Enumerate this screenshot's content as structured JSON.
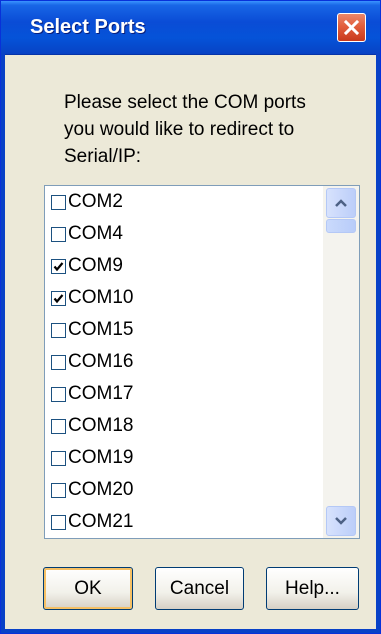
{
  "window": {
    "title": "Select Ports"
  },
  "prompt": {
    "lines": [
      "Please select the COM ports",
      "you would like to redirect to",
      "Serial/IP:"
    ]
  },
  "ports": [
    {
      "label": "COM2",
      "checked": false
    },
    {
      "label": "COM4",
      "checked": false
    },
    {
      "label": "COM9",
      "checked": true
    },
    {
      "label": "COM10",
      "checked": true
    },
    {
      "label": "COM15",
      "checked": false
    },
    {
      "label": "COM16",
      "checked": false
    },
    {
      "label": "COM17",
      "checked": false
    },
    {
      "label": "COM18",
      "checked": false
    },
    {
      "label": "COM19",
      "checked": false
    },
    {
      "label": "COM20",
      "checked": false
    },
    {
      "label": "COM21",
      "checked": false
    }
  ],
  "buttons": {
    "ok": "OK",
    "cancel": "Cancel",
    "help": "Help..."
  },
  "icons": {
    "close": "close-icon",
    "scroll_up": "chevron-up-icon",
    "scroll_down": "chevron-down-icon",
    "checkmark": "checkmark-icon"
  },
  "colors": {
    "title_bar": "#0A4CD6",
    "close_button": "#E25E3C",
    "dialog_background": "#ECE9D8"
  }
}
